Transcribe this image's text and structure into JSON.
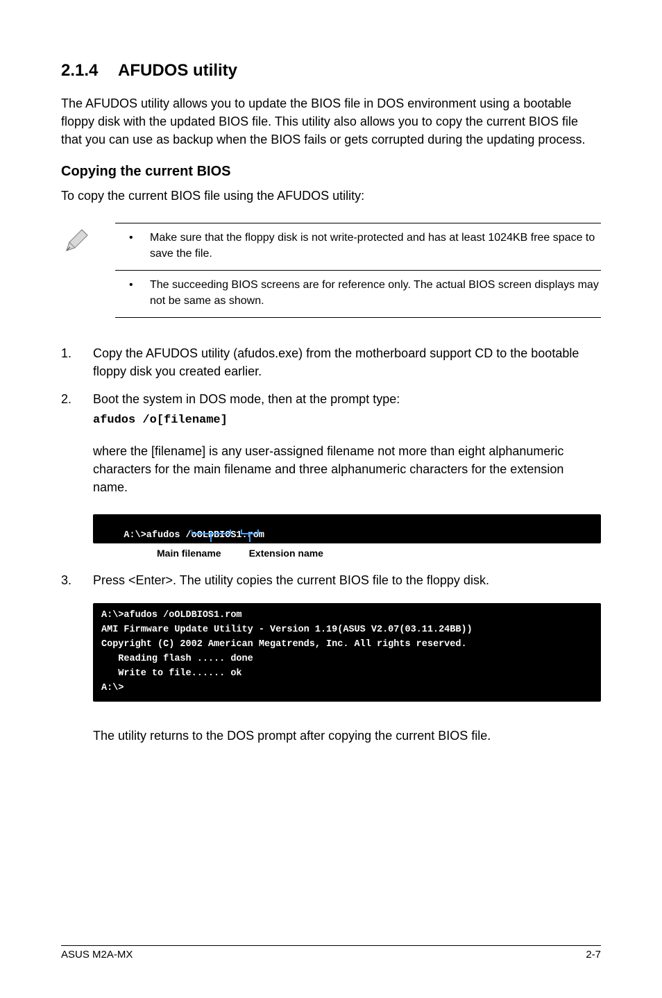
{
  "section": {
    "number": "2.1.4",
    "title": "AFUDOS utility",
    "intro": "The AFUDOS utility allows you to update the BIOS file in DOS environment using a bootable floppy disk with the updated BIOS file. This utility also allows you to copy the current BIOS file that you can use as backup when the BIOS fails or gets corrupted during the updating process."
  },
  "sub": {
    "title": "Copying the current BIOS",
    "lead": "To copy the current BIOS file using the AFUDOS utility:"
  },
  "notes": {
    "item1": "Make sure that the floppy disk is not write-protected and has at least 1024KB free space to save the file.",
    "item2": "The succeeding BIOS screens are for reference only. The actual BIOS screen displays may not be same as shown."
  },
  "steps": {
    "s1_num": "1.",
    "s1": "Copy the AFUDOS utility (afudos.exe) from the motherboard support CD to the bootable floppy disk you created earlier.",
    "s2_num": "2.",
    "s2": "Boot the system in DOS mode, then at the prompt type:",
    "s2_code": "afudos /o[filename]",
    "s2_after": "where the [filename] is any user-assigned filename not more than eight alphanumeric characters  for the main filename and three alphanumeric characters for the extension name.",
    "s3_num": "3.",
    "s3": "Press <Enter>. The utility copies the current BIOS file to the floppy disk."
  },
  "terminal1": {
    "line": "A:\\>afudos /oOLDBIOS1.rom",
    "label_main": "Main filename",
    "label_ext": "Extension name"
  },
  "terminal2": {
    "l1": "A:\\>afudos /oOLDBIOS1.rom",
    "l2": "AMI Firmware Update Utility - Version 1.19(ASUS V2.07(03.11.24BB))",
    "l3": "Copyright (C) 2002 American Megatrends, Inc. All rights reserved.",
    "l4": "   Reading flash ..... done",
    "l5": "   Write to file...... ok",
    "l6": "A:\\>"
  },
  "after_term2": "The utility returns to the DOS prompt after copying the current BIOS file.",
  "footer": {
    "left": "ASUS M2A-MX",
    "right": "2-7"
  }
}
